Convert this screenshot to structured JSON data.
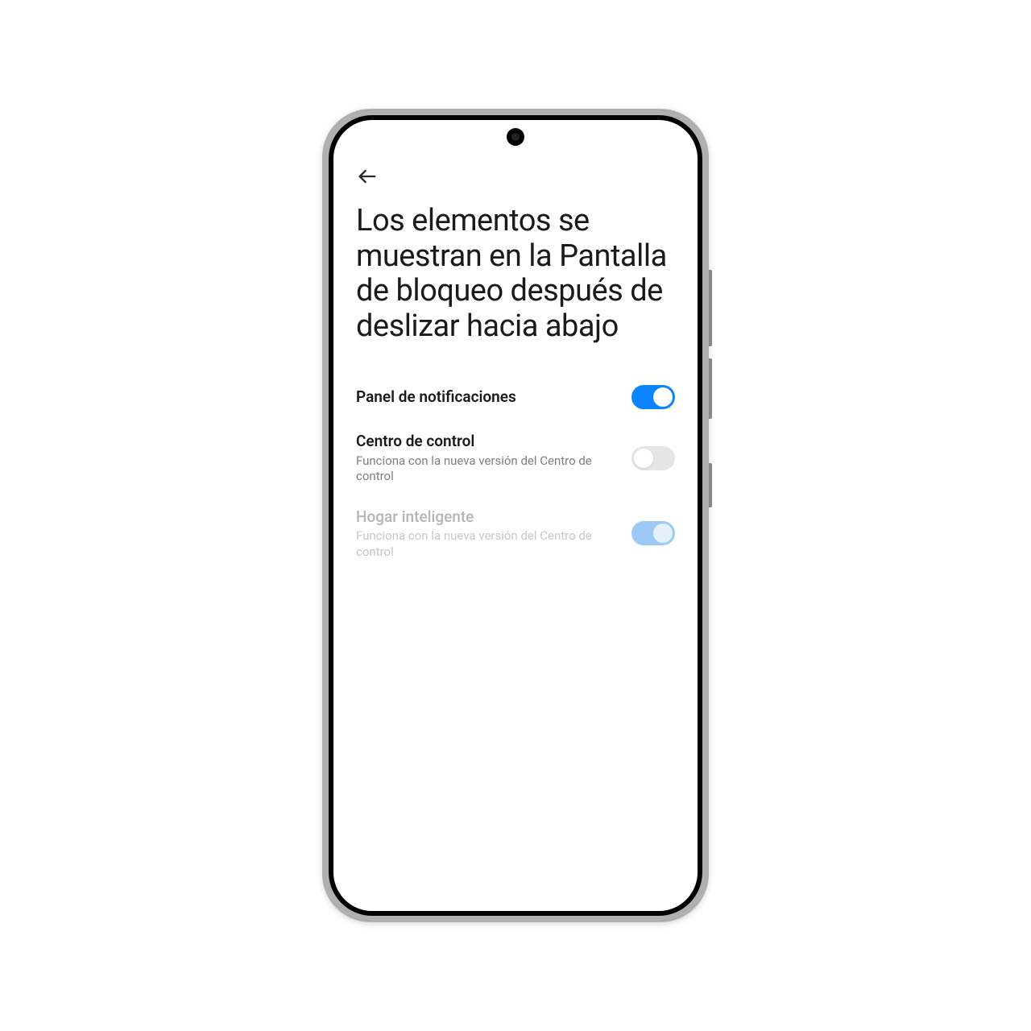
{
  "header": {
    "title": "Los elementos se muestran en la Pantalla de bloqueo después de deslizar hacia abajo"
  },
  "settings": {
    "notification_panel": {
      "label": "Panel de notificaciones",
      "on": true,
      "disabled": false
    },
    "control_center": {
      "label": "Centro de control",
      "description": "Funciona con la nueva versión del Centro de control",
      "on": false,
      "disabled": false
    },
    "smart_home": {
      "label": "Hogar inteligente",
      "description": "Funciona con la nueva versión del Centro de control",
      "on": true,
      "disabled": true
    }
  },
  "colors": {
    "accent": "#0a84ff"
  }
}
